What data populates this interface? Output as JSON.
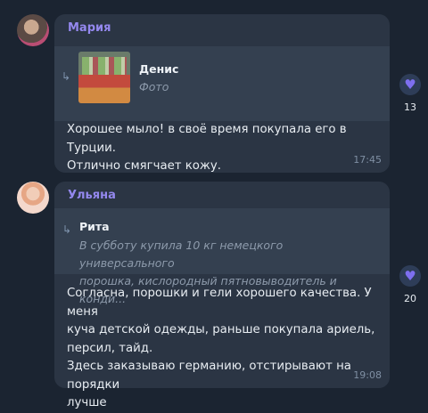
{
  "messages": [
    {
      "sender": "Мария",
      "reply": {
        "name": "Денис",
        "subtitle": "Фото"
      },
      "text": "Хорошее мыло! в своё время покупала его в Турции.\nОтлично смягчает кожу.",
      "time": "17:45",
      "reaction": {
        "icon": "heart-icon",
        "count": "13"
      }
    },
    {
      "sender": "Ульяна",
      "reply": {
        "name": "Рита",
        "subtitle": "В субботу купила 10 кг немецкого универсального\nпорошка, кислородный пятновыводитель и конди..."
      },
      "text": "Согласна, порошки и гели хорошего качества. У меня\nкуча детской одежды, раньше покупала ариель,\nперсил, тайд.\nЗдесь заказываю германию, отстирывают на порядки\nлучше",
      "time": "19:08",
      "reaction": {
        "icon": "heart-icon",
        "count": "20"
      }
    }
  ],
  "colors": {
    "background": "#1b2431",
    "bubble": "#2b3544",
    "reply_box": "#344050",
    "sender_name": "#9488ee",
    "reaction_heart": "#7e6ff0"
  }
}
